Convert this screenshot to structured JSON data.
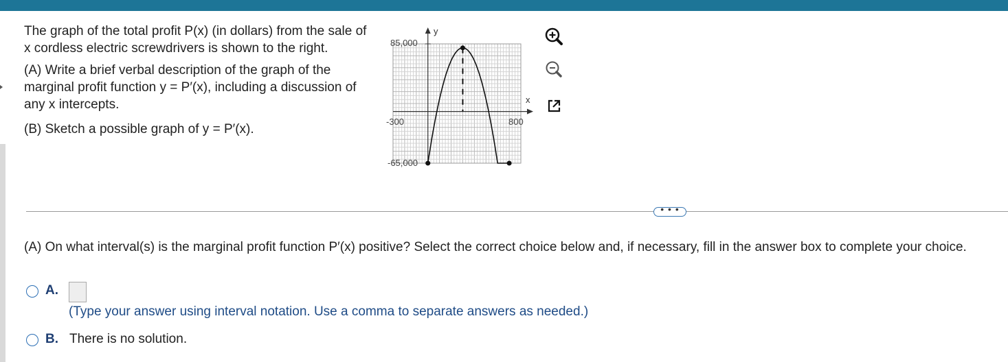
{
  "problem": {
    "intro_line1": "The graph of the total profit P(x) (in dollars) from the sale of",
    "intro_line2": "x cordless electric screwdrivers is shown to the right.",
    "part_a_line1": "(A) Write a brief verbal description of the graph of the",
    "part_a_line2": "marginal profit function y = P′(x), including a discussion of",
    "part_a_line3": "any x intercepts.",
    "part_b": "(B) Sketch a possible graph of y = P′(x)."
  },
  "graph": {
    "y_axis_label": "y",
    "x_axis_label": "x",
    "y_max_label": "85,000",
    "y_min_label": "-65,000",
    "x_min_label": "-300",
    "x_max_label": "800"
  },
  "chart_data": {
    "type": "line",
    "x": [
      0,
      100,
      200,
      300,
      400,
      500,
      600,
      700
    ],
    "y": [
      -65000,
      10000,
      60000,
      80000,
      60000,
      10000,
      -65000,
      -65000
    ],
    "curve_points": [
      {
        "x": 0,
        "y": -65000
      },
      {
        "x": 300,
        "y": 80000
      },
      {
        "x": 700,
        "y": -65000
      }
    ],
    "xlim": [
      -300,
      800
    ],
    "ylim": [
      -65000,
      85000
    ],
    "xlabel": "x",
    "ylabel": "y",
    "grid": true
  },
  "tools": {
    "zoom_in": "zoom-in",
    "zoom_out": "zoom-out",
    "pop_out": "open-in-new-window"
  },
  "more_button": "• • •",
  "question": "(A) On what interval(s) is the marginal profit function P′(x) positive? Select the correct choice below and, if necessary, fill in the answer box to complete your choice.",
  "choices": {
    "a_letter": "A.",
    "a_answer_value": "",
    "a_hint": "(Type your answer using interval notation. Use a comma to separate answers as needed.)",
    "b_letter": "B.",
    "b_text": "There is no solution."
  },
  "colors": {
    "top_bar": "#1d7597",
    "radio_border": "#2c6fb5",
    "choice_letter": "#1f3f73",
    "hint_text": "#1e4b86"
  }
}
